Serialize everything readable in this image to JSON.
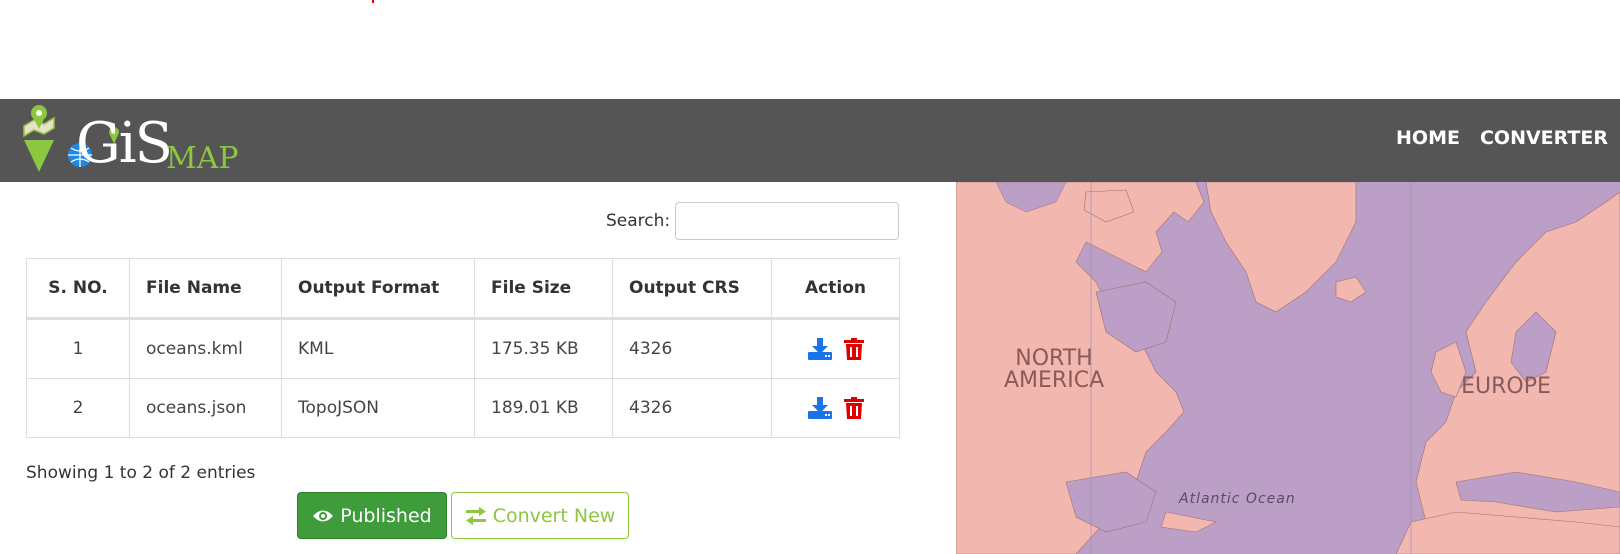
{
  "header": {
    "logo_gis": "GiS",
    "logo_map": "MAP",
    "nav": [
      {
        "label": "HOME"
      },
      {
        "label": "CONVERTER"
      }
    ]
  },
  "search": {
    "label": "Search:",
    "value": "",
    "placeholder": ""
  },
  "table": {
    "columns": [
      "S. NO.",
      "File Name",
      "Output Format",
      "File Size",
      "Output CRS",
      "Action"
    ],
    "rows": [
      {
        "sno": "1",
        "file_name": "oceans.kml",
        "format": "KML",
        "size": "175.35 KB",
        "crs": "4326",
        "actions": [
          "download-icon",
          "trash-icon"
        ]
      },
      {
        "sno": "2",
        "file_name": "oceans.json",
        "format": "TopoJSON",
        "size": "189.01 KB",
        "crs": "4326",
        "actions": [
          "download-icon",
          "trash-icon"
        ]
      }
    ]
  },
  "info": "Showing 1 to 2 of 2 entries",
  "buttons": {
    "published": "Published",
    "convert_new": "Convert New"
  },
  "map": {
    "labels": {
      "north_america": "NORTH AMERICA",
      "europe": "EUROPE",
      "atlantic": "Atlantic Ocean"
    }
  },
  "colors": {
    "navbar": "#555555",
    "brand_green": "#8dc63f",
    "published_green": "#3e9c3a",
    "download_blue": "#1a73e8",
    "delete_red": "#e00000",
    "map_land": "#f2b8b0",
    "map_water": "#bb9fc6"
  }
}
